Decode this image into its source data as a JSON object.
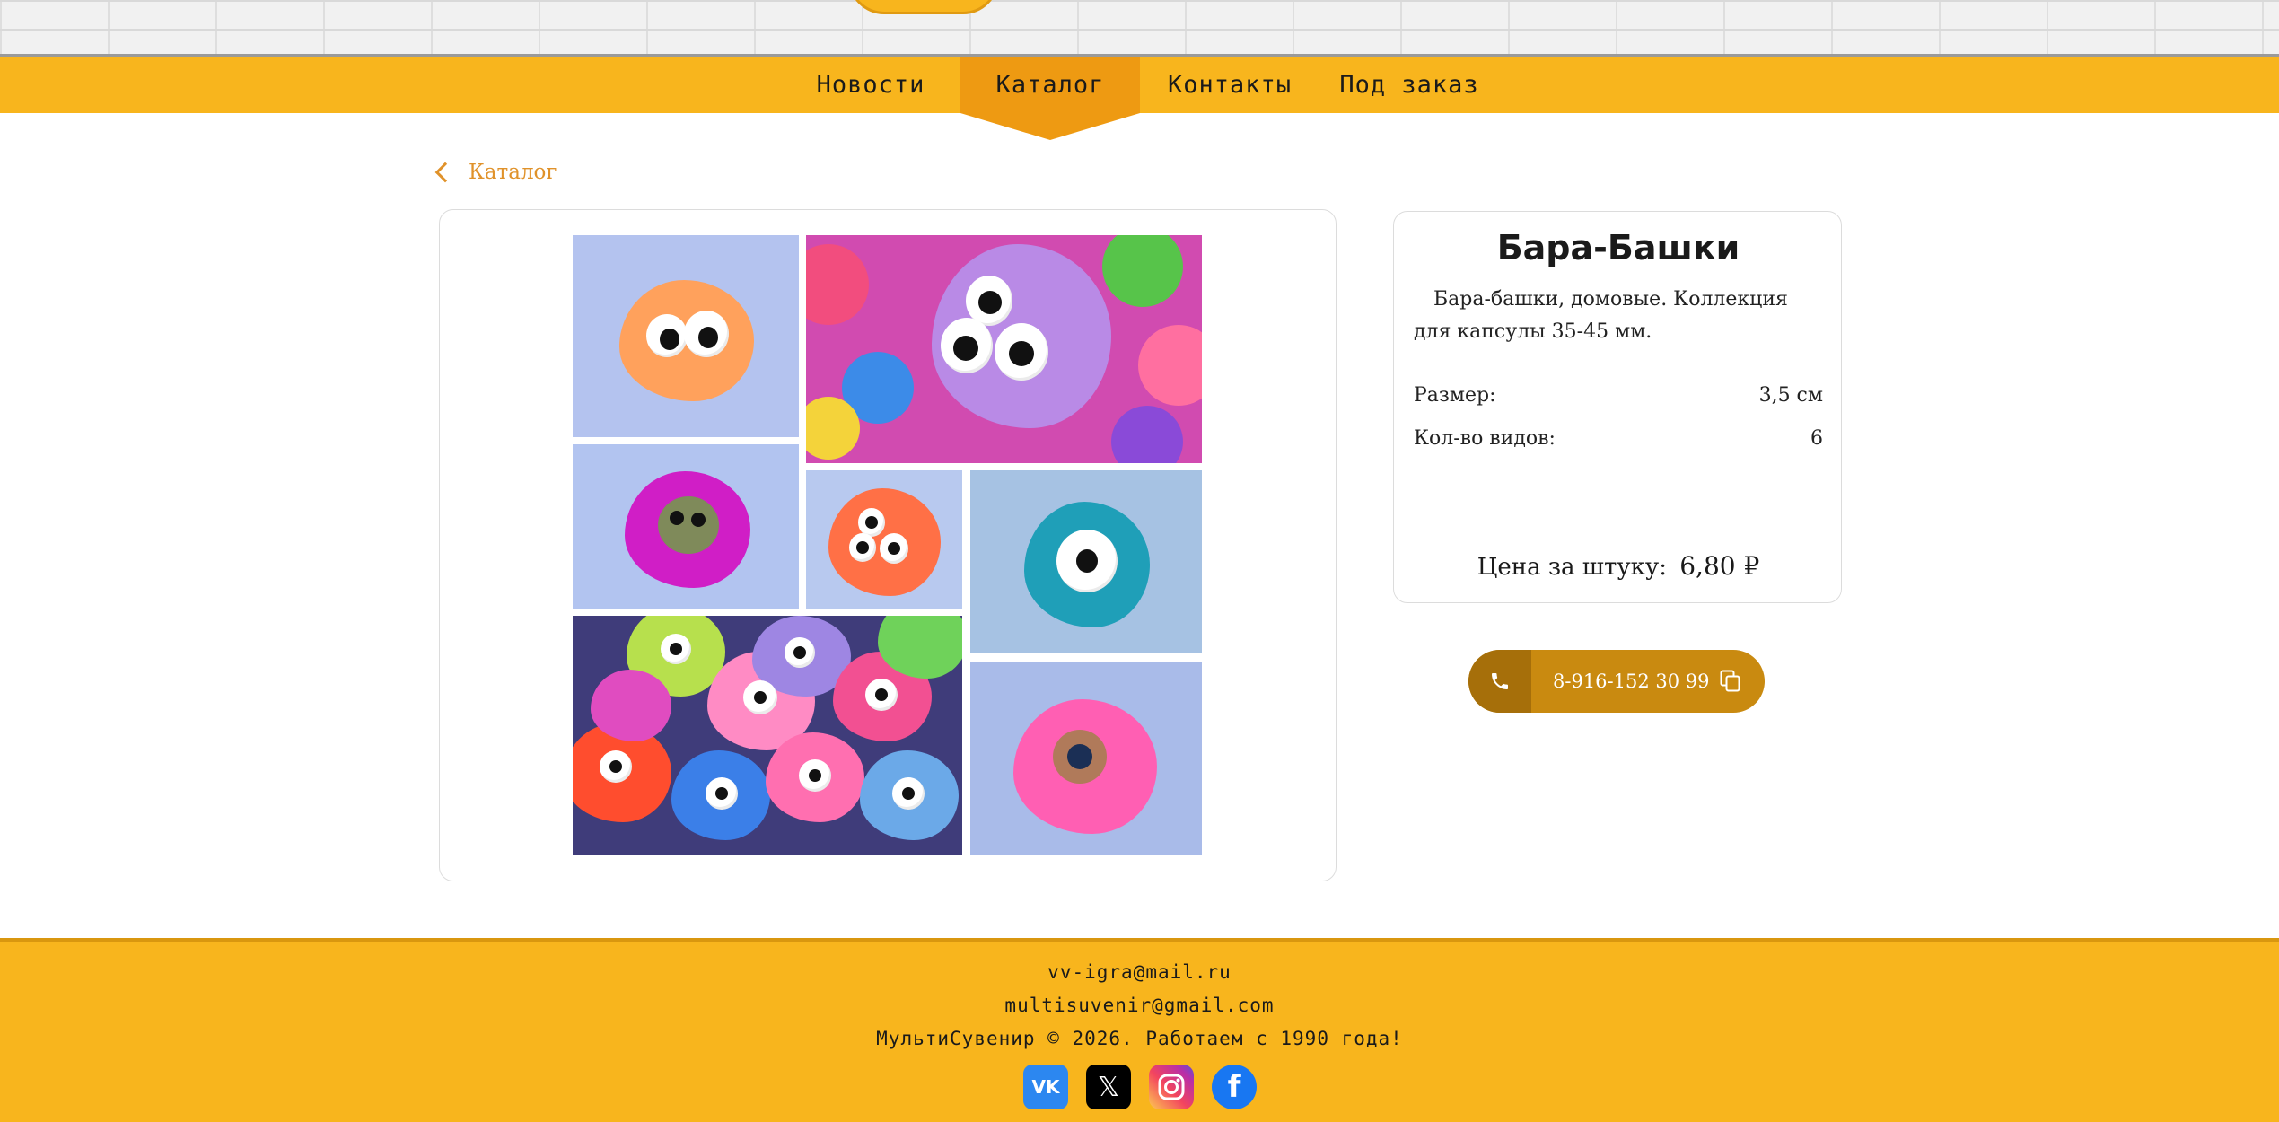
{
  "nav": {
    "items": [
      {
        "label": "Новости"
      },
      {
        "label": "Каталог"
      },
      {
        "label": "Контакты"
      },
      {
        "label": "Под заказ"
      }
    ]
  },
  "breadcrumb": {
    "label": "Каталог"
  },
  "product": {
    "title": "Бара-Башки",
    "description": "Бара-башки, домовые. Коллекция для капсулы 35-45 мм.",
    "specs": [
      {
        "label": "Размер:",
        "value": "3,5 см"
      },
      {
        "label": "Кол-во видов:",
        "value": "6"
      }
    ],
    "price_label": "Цена за штуку:",
    "price_value": "6,80 ₽"
  },
  "contact": {
    "phone": "8-916-152 30 99"
  },
  "footer": {
    "email1": "vv-igra@mail.ru",
    "email2": "multisuvenir@gmail.com",
    "copyright": "МультиСувенир © 2026. Работаем с 1990 года!"
  },
  "socials": [
    "vk-icon",
    "x-icon",
    "instagram-icon",
    "facebook-icon"
  ],
  "colors": {
    "accent": "#f8b51d",
    "accent_dark": "#ee9a12",
    "link": "#e0922a",
    "phone_bg": "#c98a10"
  }
}
